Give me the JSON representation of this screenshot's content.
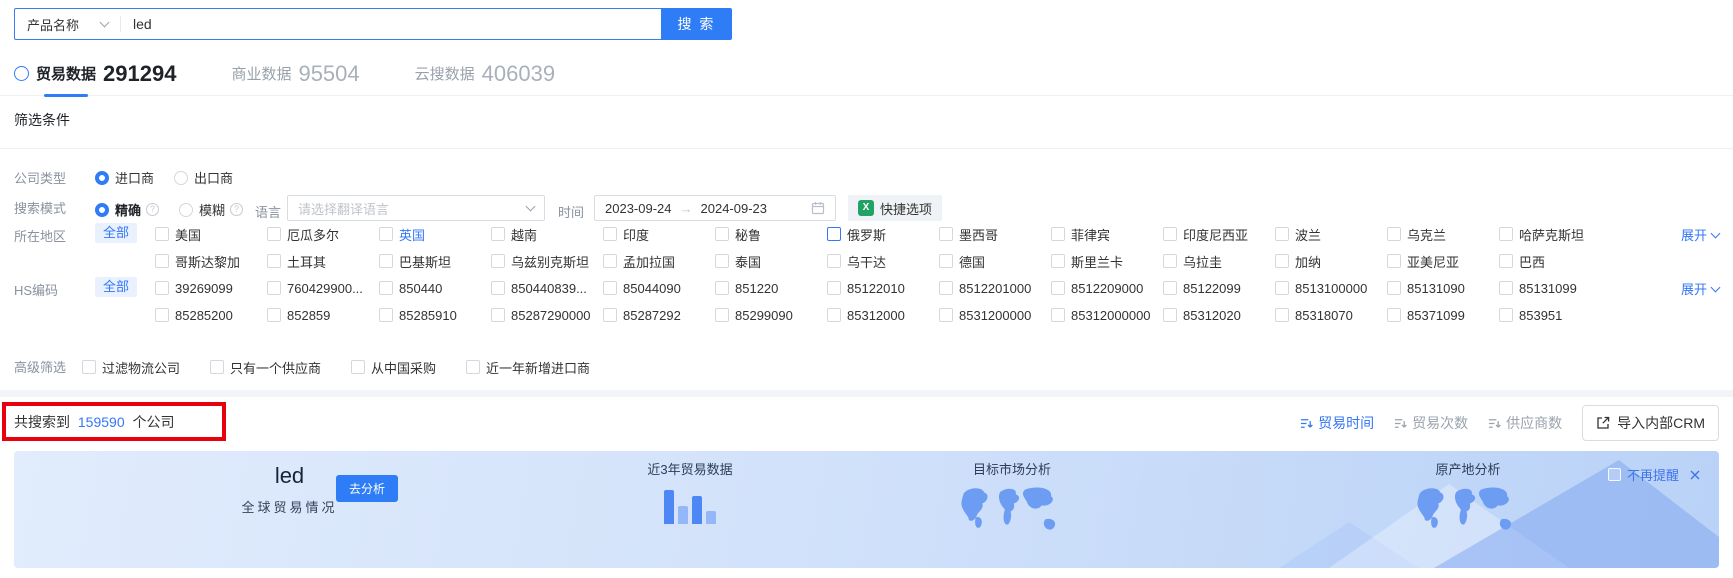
{
  "search": {
    "category": "产品名称",
    "query": "led",
    "button": "搜 索"
  },
  "tabs": [
    {
      "label": "贸易数据",
      "count": "291294",
      "active": true,
      "help": true
    },
    {
      "label": "商业数据",
      "count": "95504"
    },
    {
      "label": "云搜数据",
      "count": "406039"
    }
  ],
  "filters": {
    "title": "筛选条件",
    "company_type": {
      "label": "公司类型",
      "options": [
        {
          "label": "进口商",
          "selected": true
        },
        {
          "label": "出口商"
        }
      ]
    },
    "search_mode": {
      "label": "搜索模式",
      "options": [
        {
          "label": "精确",
          "selected": true,
          "bold": true
        },
        {
          "label": "模糊"
        }
      ]
    },
    "language": {
      "label": "语言",
      "placeholder": "请选择翻译语言"
    },
    "time": {
      "label": "时间",
      "start": "2023-09-24",
      "end": "2024-09-23"
    },
    "quick_option": "快捷选项",
    "region": {
      "label": "所在地区",
      "all": "全部",
      "expand": "展开",
      "row1": [
        {
          "label": "美国"
        },
        {
          "label": "厄瓜多尔"
        },
        {
          "label": "英国",
          "highlight": true
        },
        {
          "label": "越南"
        },
        {
          "label": "印度"
        },
        {
          "label": "秘鲁"
        },
        {
          "label": "俄罗斯",
          "boxhl": true
        },
        {
          "label": "墨西哥"
        },
        {
          "label": "菲律宾"
        },
        {
          "label": "印度尼西亚"
        },
        {
          "label": "波兰"
        },
        {
          "label": "乌克兰"
        },
        {
          "label": "哈萨克斯坦"
        }
      ],
      "row2": [
        {
          "label": "哥斯达黎加"
        },
        {
          "label": "土耳其"
        },
        {
          "label": "巴基斯坦"
        },
        {
          "label": "乌兹别克斯坦"
        },
        {
          "label": "孟加拉国"
        },
        {
          "label": "泰国"
        },
        {
          "label": "乌干达"
        },
        {
          "label": "德国"
        },
        {
          "label": "斯里兰卡"
        },
        {
          "label": "乌拉圭"
        },
        {
          "label": "加纳"
        },
        {
          "label": "亚美尼亚"
        },
        {
          "label": "巴西"
        }
      ]
    },
    "hs_code": {
      "label": "HS编码",
      "all": "全部",
      "expand": "展开",
      "row1": [
        {
          "label": "39269099"
        },
        {
          "label": "760429900..."
        },
        {
          "label": "850440"
        },
        {
          "label": "850440839..."
        },
        {
          "label": "85044090"
        },
        {
          "label": "851220"
        },
        {
          "label": "85122010"
        },
        {
          "label": "8512201000"
        },
        {
          "label": "8512209000"
        },
        {
          "label": "85122099"
        },
        {
          "label": "8513100000"
        },
        {
          "label": "85131090"
        },
        {
          "label": "85131099"
        }
      ],
      "row2": [
        {
          "label": "85285200"
        },
        {
          "label": "852859"
        },
        {
          "label": "85285910"
        },
        {
          "label": "85287290000"
        },
        {
          "label": "85287292"
        },
        {
          "label": "85299090"
        },
        {
          "label": "85312000"
        },
        {
          "label": "8531200000"
        },
        {
          "label": "85312000000"
        },
        {
          "label": "85312020"
        },
        {
          "label": "85318070"
        },
        {
          "label": "85371099"
        },
        {
          "label": "853951"
        }
      ]
    },
    "advanced": {
      "label": "高级筛选",
      "options": [
        {
          "label": "过滤物流公司"
        },
        {
          "label": "只有一个供应商"
        },
        {
          "label": "从中国采购"
        },
        {
          "label": "近一年新增进口商"
        }
      ]
    }
  },
  "results": {
    "prefix": "共搜索到",
    "count": "159590",
    "suffix": "个公司",
    "sorts": [
      {
        "label": "贸易时间",
        "active": true
      },
      {
        "label": "贸易次数"
      },
      {
        "label": "供应商数"
      }
    ],
    "import_crm": "导入内部CRM"
  },
  "banner": {
    "keyword": "led",
    "subtitle": "全球贸易情况",
    "analyze": "去分析",
    "section_trade": "近3年贸易数据",
    "section_market": "目标市场分析",
    "section_origin": "原产地分析",
    "dismiss": "不再提醒"
  },
  "colors": {
    "accent": "#2e7cf6",
    "link": "#3377f6",
    "annotation_red": "#e8000d"
  }
}
